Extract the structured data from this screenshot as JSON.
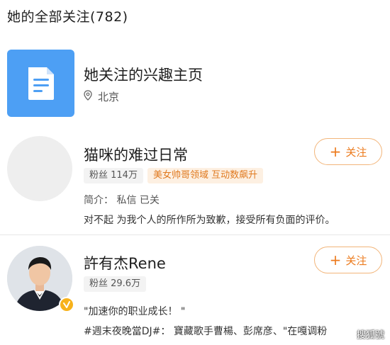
{
  "header": {
    "title": "她的全部关注(782)"
  },
  "interest_page": {
    "title": "她关注的兴趣主页",
    "location": "北京",
    "icons": {
      "tile": "document-icon",
      "location": "location-pin-icon"
    }
  },
  "users": [
    {
      "name": "猫咪的难过日常",
      "follow_label": "关注",
      "fans": "粉丝  114万",
      "honor": "美女帅哥领域 互动数飙升",
      "intro": "简介：  私信  已关",
      "desc": "对不起 为我个人的所作所为致歉，接受所有负面的评价。"
    },
    {
      "name": "許有杰Rene",
      "follow_label": "关注",
      "fans": "粉丝  29.6万",
      "desc1": "\"加速你的职业成长！ \"",
      "desc2": "#週末夜晚當DJ#：  寶藏歌手曹楊、彭席彦、\"在嘎调粉",
      "verified": true
    }
  ],
  "watermark": "搜狐號",
  "colors": {
    "accent": "#ec7a1c",
    "tile": "#4d9ff4",
    "verify": "#f7b21b"
  }
}
